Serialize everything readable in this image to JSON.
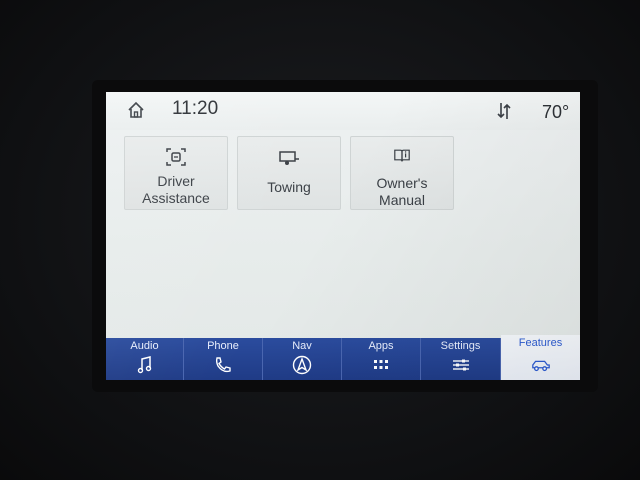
{
  "status_bar": {
    "time": "11:20",
    "temperature": "70°",
    "icons": [
      "home-icon",
      "signal-icon"
    ]
  },
  "features": {
    "tiles": [
      {
        "label_line1": "Driver",
        "label_line2": "Assistance",
        "icon": "driver-assist-icon"
      },
      {
        "label_line1": "Towing",
        "label_line2": "",
        "icon": "trailer-icon"
      },
      {
        "label_line1": "Owner's Manual",
        "label_line2": "",
        "icon": "book-icon"
      }
    ]
  },
  "nav": {
    "items": [
      {
        "label": "Audio",
        "icon": "music-note-icon"
      },
      {
        "label": "Phone",
        "icon": "phone-icon"
      },
      {
        "label": "Nav",
        "icon": "navigation-icon"
      },
      {
        "label": "Apps",
        "icon": "apps-grid-icon"
      },
      {
        "label": "Settings",
        "icon": "sliders-icon"
      },
      {
        "label": "Features",
        "icon": "vehicle-icon"
      }
    ],
    "active": "Features"
  },
  "colors": {
    "nav_bg": "#233f8c",
    "active_text": "#2c5bd0",
    "screen_bg": "#eaeeee"
  }
}
